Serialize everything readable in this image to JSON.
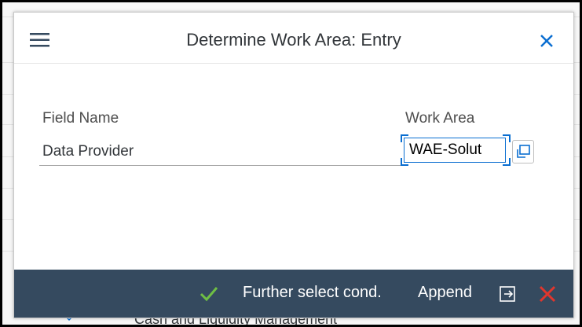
{
  "background": {
    "bottom_text": "Cash and Liquidity Management"
  },
  "dialog": {
    "title": "Determine Work Area: Entry",
    "menu_icon": "hamburger-menu-icon",
    "close_icon": "close-icon"
  },
  "table": {
    "headers": {
      "field_name": "Field Name",
      "work_area": "Work Area"
    },
    "rows": [
      {
        "field_name": "Data Provider",
        "work_area_value": "WAE-Solut"
      }
    ]
  },
  "footer": {
    "confirm_icon": "checkmark-icon",
    "further_select_label": "Further select cond.",
    "append_label": "Append",
    "export_icon": "export-icon",
    "cancel_icon": "cancel-icon"
  },
  "colors": {
    "accent": "#0a6ed1",
    "footer_bg": "#354a5f",
    "confirm_green": "#6fbf44",
    "cancel_red": "#e0362d"
  }
}
